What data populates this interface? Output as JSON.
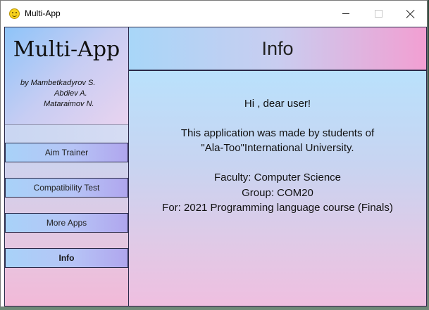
{
  "window": {
    "title": "Multi-App",
    "app_icon": "smiley-icon",
    "controls": [
      "minimize-icon",
      "maximize-icon",
      "close-icon"
    ]
  },
  "sidebar": {
    "logo": "Multi-App",
    "credits": [
      "by Mambetkadyrov S.",
      "Abdiev A.",
      "Mataraimov N."
    ],
    "items": [
      {
        "label": "Aim Trainer"
      },
      {
        "label": "Compatibility Test"
      },
      {
        "label": "More Apps"
      },
      {
        "label": "Info",
        "active": true
      }
    ]
  },
  "main": {
    "header": "Info",
    "greeting": "Hi , dear user!",
    "about_line1": "This application was made by students of",
    "about_line2": "\"Ala-Too\"International University.",
    "faculty": "Faculty: Computer Science",
    "group": "Group: COM20",
    "purpose": "For: 2021 Programming language course (Finals)"
  },
  "colors": {
    "sidebar_gradient": [
      "#a6d4f7",
      "#f2b9d8"
    ],
    "header_gradient": [
      "#a8d6f8",
      "#f29fd2"
    ],
    "border": "#2a2a4a"
  }
}
